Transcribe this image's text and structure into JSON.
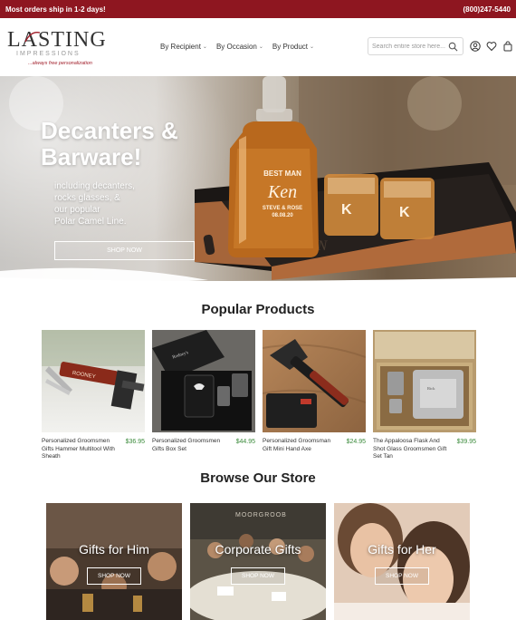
{
  "topbar": {
    "shipping_notice": "Most orders ship in 1-2 days!",
    "phone": "(800)247-5440"
  },
  "brand": {
    "name": "LASTING",
    "sub": "IMPRESSIONS",
    "tagline": "...always free personalization"
  },
  "nav": [
    {
      "label": "By Recipient"
    },
    {
      "label": "By Occasion"
    },
    {
      "label": "By Product"
    }
  ],
  "search": {
    "placeholder": "Search entire store here..."
  },
  "hero": {
    "title_line1": "Decanters &",
    "title_line2": "Barware!",
    "text_line1": "including decanters,",
    "text_line2": "rocks glasses, &",
    "text_line3": "our popular",
    "text_line4": "Polar Camel Line.",
    "button": "SHOP NOW",
    "decanter_line1": "BEST MAN",
    "decanter_name": "Ken",
    "decanter_line3": "STEVE & ROSE",
    "decanter_line4": "08.08.20",
    "glass_letter": "K"
  },
  "popular": {
    "title": "Popular Products",
    "items": [
      {
        "name": "Personalized Groomsmen Gifts Hammer Multitool With Sheath",
        "price": "$36.95"
      },
      {
        "name": "Personalized Groomsmen Gifts Box Set",
        "price": "$44.95"
      },
      {
        "name": "Personalized Groomsman Gift Mini Hand Axe",
        "price": "$24.95"
      },
      {
        "name": "The Appaloosa Flask And Shot Glass Groomsmen Gift Set Tan",
        "price": "$39.95"
      }
    ]
  },
  "browse": {
    "title": "Browse Our Store",
    "items": [
      {
        "label": "Gifts for Him",
        "button": "SHOP NOW"
      },
      {
        "label": "Corporate Gifts",
        "button": "SHOP NOW"
      },
      {
        "label": "Gifts for Her",
        "button": "SHOP NOW"
      }
    ]
  },
  "colors": {
    "brand_red": "#8e1620",
    "price_green": "#3a8a3a"
  }
}
